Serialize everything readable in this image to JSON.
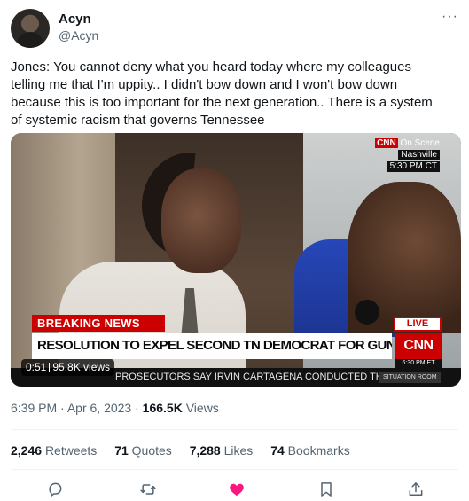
{
  "author": {
    "name": "Acyn",
    "handle": "@Acyn"
  },
  "menu": {
    "more_icon": "more-horizontal-icon",
    "more_label": "···"
  },
  "tweet": {
    "text": "Jones: You cannot deny what you heard today where my colleagues telling me that I'm uppity.. I didn't bow down and I won't bow down because this is too important for the next generation.. There is a system of systemic racism that governs Tennessee"
  },
  "media": {
    "broadcast": {
      "network_mini": "CNN",
      "on_scene": "On Scene",
      "location": "Nashville",
      "time": "5:30 PM CT",
      "breaking_label": "BREAKING NEWS",
      "live_label": "LIVE",
      "headline": "RESOLUTION TO EXPEL SECOND TN DEMOCRAT FOR GUN PROTEST FAILS",
      "network_logo": "CNN",
      "logo_time": "6:30 PM ET",
      "ticker": "PROSECUTORS SAY IRVIN CARTAGENA CONDUCTED THE",
      "show_name": "SITUATION ROOM"
    },
    "duration": "0:51",
    "views": "95.8K views"
  },
  "meta": {
    "time": "6:39 PM",
    "separator": "·",
    "date": "Apr 6, 2023",
    "view_count": "166.5K",
    "view_label": "Views"
  },
  "stats": {
    "retweets_count": "2,246",
    "retweets_label": "Retweets",
    "quotes_count": "71",
    "quotes_label": "Quotes",
    "likes_count": "7,288",
    "likes_label": "Likes",
    "bookmarks_count": "74",
    "bookmarks_label": "Bookmarks"
  },
  "actions": {
    "reply_icon": "reply-icon",
    "retweet_icon": "retweet-icon",
    "like_icon": "like-icon",
    "bookmark_icon": "bookmark-icon",
    "share_icon": "share-icon"
  },
  "colors": {
    "text_primary": "#0f1419",
    "text_secondary": "#536471",
    "like_active": "#f91880",
    "cnn_red": "#cc0000",
    "divider": "#eff3f4"
  }
}
